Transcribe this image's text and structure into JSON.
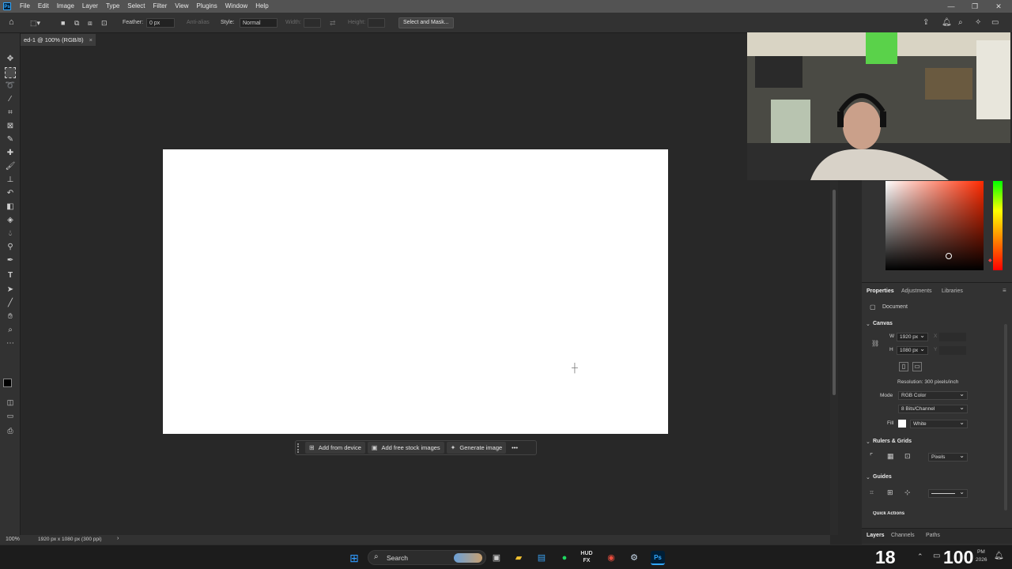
{
  "menu": {
    "items": [
      "File",
      "Edit",
      "Image",
      "Layer",
      "Type",
      "Select",
      "Filter",
      "View",
      "Plugins",
      "Window",
      "Help"
    ],
    "min": "—",
    "max": "❐",
    "close": "✕"
  },
  "options_bar": {
    "feather_label": "Feather:",
    "feather_value": "0 px",
    "antialias_label": "Anti-alias",
    "style_label": "Style:",
    "style_value": "Normal",
    "width_label": "Width:",
    "height_label": "Height:",
    "select_mask": "Select and Mask..."
  },
  "document_tab": {
    "title": "ed-1 @ 100% (RGB/8)",
    "close": "×"
  },
  "contextual_bar": {
    "add_device": "Add from device",
    "add_stock": "Add free stock images",
    "generate": "Generate image",
    "more": "•••"
  },
  "status_bar": {
    "zoom": "100%",
    "doc_info": "1920 px x 1080 px (300 ppi)"
  },
  "properties": {
    "tabs": [
      "Properties",
      "Adjustments",
      "Libraries"
    ],
    "document_label": "Document",
    "canvas_section": "Canvas",
    "w_label": "W",
    "w_value": "1920 px",
    "h_label": "H",
    "h_value": "1080 px",
    "x_label": "X",
    "y_label": "Y",
    "resolution": "Resolution: 300 pixels/inch",
    "mode_label": "Mode",
    "mode_value": "RGB Color",
    "bits_value": "8 Bits/Channel",
    "fill_label": "Fill",
    "fill_value": "White",
    "rulers_section": "Rulers & Grids",
    "units_value": "Pixels",
    "guides_section": "Guides",
    "quick_actions": "Quick Actions"
  },
  "bottom_tabs": [
    "Layers",
    "Channels",
    "Paths"
  ],
  "taskbar": {
    "search": "Search",
    "hud_label": "HUD FX",
    "overlay_number_1": "18",
    "overlay_number_2": "100",
    "time": "PM",
    "date": "2026"
  },
  "colors": {
    "app_bg": "#282828",
    "panel_bg": "#323232",
    "menubar": "#535353",
    "canvas": "#ffffff",
    "ps_blue": "#31a8ff"
  }
}
